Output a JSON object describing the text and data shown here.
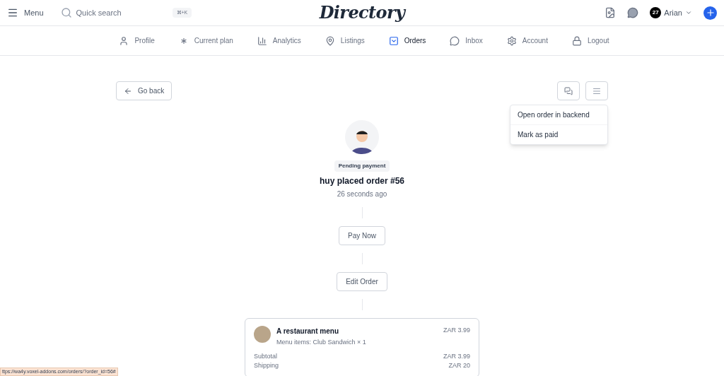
{
  "header": {
    "menu_label": "Menu",
    "search_placeholder": "Quick search",
    "shortcut": "⌘+K",
    "logo": "Directory",
    "user_badge": "27",
    "user_name": "Arian"
  },
  "nav": [
    {
      "label": "Profile",
      "selected": false
    },
    {
      "label": "Current plan",
      "selected": false
    },
    {
      "label": "Analytics",
      "selected": false
    },
    {
      "label": "Listings",
      "selected": false
    },
    {
      "label": "Orders",
      "selected": true
    },
    {
      "label": "Inbox",
      "selected": false
    },
    {
      "label": "Account",
      "selected": false
    },
    {
      "label": "Logout",
      "selected": false
    }
  ],
  "back_button": "Go back",
  "actions_menu": [
    "Open order in backend",
    "Mark as paid"
  ],
  "order": {
    "status": "Pending payment",
    "title": "huy placed order #56",
    "time": "26 seconds ago"
  },
  "steps": [
    "Pay Now",
    "Edit Order"
  ],
  "summary": {
    "item_title": "A restaurant menu",
    "item_detail": "Menu items: Club Sandwich × 1",
    "item_price": "ZAR 3.99",
    "lines": [
      {
        "label": "Subtotal",
        "value": "ZAR 3.99"
      },
      {
        "label": "Shipping",
        "value": "ZAR 20"
      }
    ]
  },
  "status_url": "ttps://wa4y.voxel-addons.com/orders/?order_id=56#"
}
